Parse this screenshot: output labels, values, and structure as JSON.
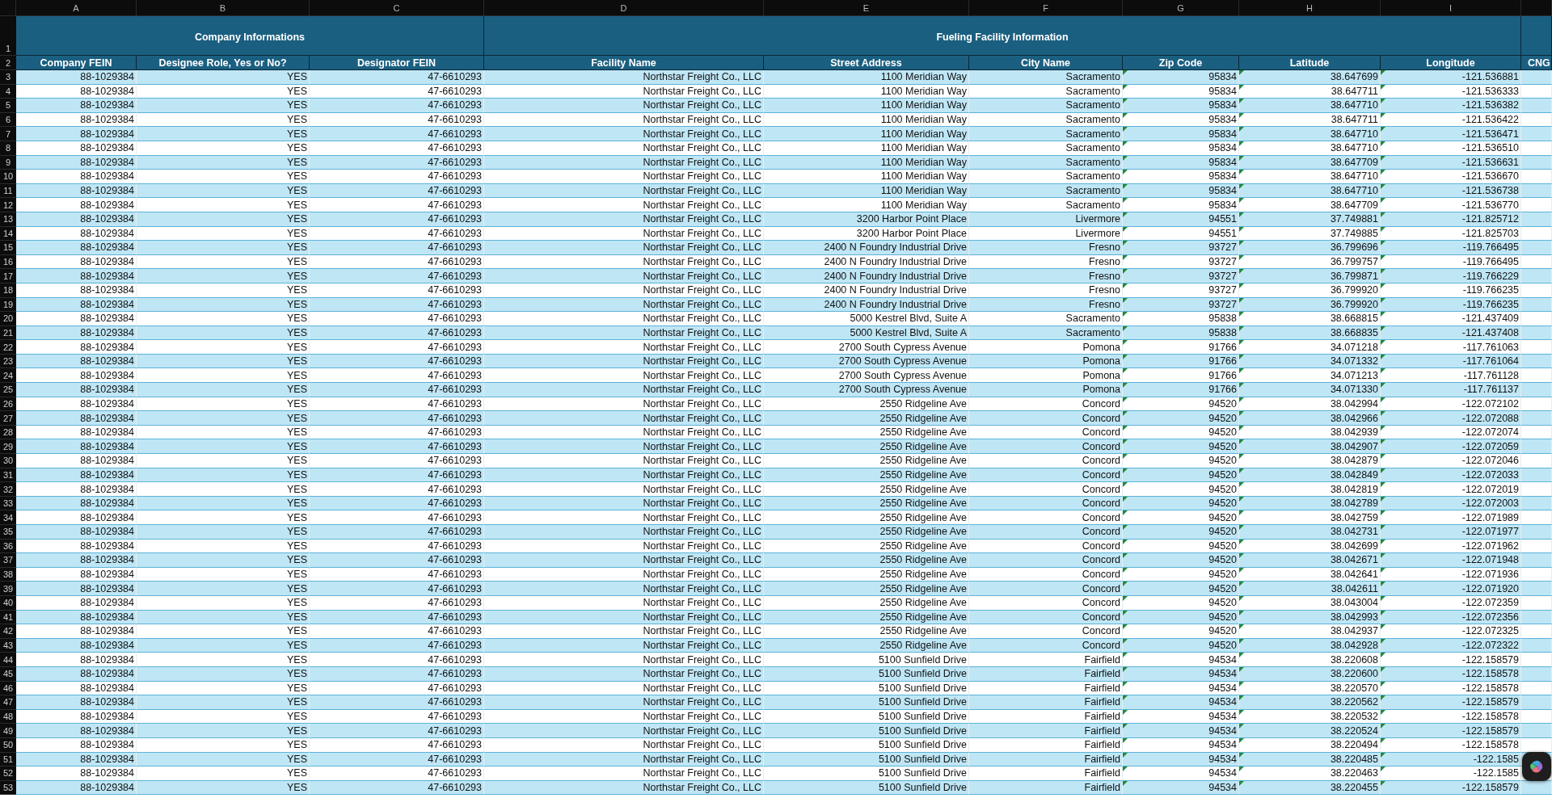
{
  "column_letters": [
    "A",
    "B",
    "C",
    "D",
    "E",
    "F",
    "G",
    "H",
    "I"
  ],
  "header_row_numbers": [
    "1",
    "2"
  ],
  "header_groups": [
    {
      "title": "Company Informations",
      "columns": [
        {
          "header": "Company FEIN",
          "flagged": false
        },
        {
          "header": "Designee Role, Yes or No?",
          "flagged": false
        },
        {
          "header": "Designator FEIN",
          "flagged": false
        }
      ]
    },
    {
      "title": "Fueling Facility Information",
      "columns": [
        {
          "header": "Facility Name",
          "flagged": false
        },
        {
          "header": "Street Address",
          "flagged": false
        },
        {
          "header": "City Name",
          "flagged": false
        },
        {
          "header": "Zip Code",
          "flagged": true
        },
        {
          "header": "Latitude",
          "flagged": true
        },
        {
          "header": "Longitude",
          "flagged": true
        }
      ]
    },
    {
      "columns": [
        {
          "header": "CNG",
          "flagged": false
        }
      ]
    }
  ],
  "rows": [
    {
      "number": "3",
      "cells": [
        "88-1029384",
        "YES",
        "47-6610293",
        "Northstar Freight Co., LLC",
        "1100 Meridian Way",
        "Sacramento",
        "95834",
        "38.647699",
        "-121.536881"
      ]
    },
    {
      "number": "4",
      "cells": [
        "88-1029384",
        "YES",
        "47-6610293",
        "Northstar Freight Co., LLC",
        "1100 Meridian Way",
        "Sacramento",
        "95834",
        "38.647711",
        "-121.536333"
      ]
    },
    {
      "number": "5",
      "cells": [
        "88-1029384",
        "YES",
        "47-6610293",
        "Northstar Freight Co., LLC",
        "1100 Meridian Way",
        "Sacramento",
        "95834",
        "38.647710",
        "-121.536382"
      ]
    },
    {
      "number": "6",
      "cells": [
        "88-1029384",
        "YES",
        "47-6610293",
        "Northstar Freight Co., LLC",
        "1100 Meridian Way",
        "Sacramento",
        "95834",
        "38.647711",
        "-121.536422"
      ]
    },
    {
      "number": "7",
      "cells": [
        "88-1029384",
        "YES",
        "47-6610293",
        "Northstar Freight Co., LLC",
        "1100 Meridian Way",
        "Sacramento",
        "95834",
        "38.647710",
        "-121.536471"
      ]
    },
    {
      "number": "8",
      "cells": [
        "88-1029384",
        "YES",
        "47-6610293",
        "Northstar Freight Co., LLC",
        "1100 Meridian Way",
        "Sacramento",
        "95834",
        "38.647710",
        "-121.536510"
      ]
    },
    {
      "number": "9",
      "cells": [
        "88-1029384",
        "YES",
        "47-6610293",
        "Northstar Freight Co., LLC",
        "1100 Meridian Way",
        "Sacramento",
        "95834",
        "38.647709",
        "-121.536631"
      ]
    },
    {
      "number": "10",
      "cells": [
        "88-1029384",
        "YES",
        "47-6610293",
        "Northstar Freight Co., LLC",
        "1100 Meridian Way",
        "Sacramento",
        "95834",
        "38.647710",
        "-121.536670"
      ]
    },
    {
      "number": "11",
      "cells": [
        "88-1029384",
        "YES",
        "47-6610293",
        "Northstar Freight Co., LLC",
        "1100 Meridian Way",
        "Sacramento",
        "95834",
        "38.647710",
        "-121.536738"
      ]
    },
    {
      "number": "12",
      "cells": [
        "88-1029384",
        "YES",
        "47-6610293",
        "Northstar Freight Co., LLC",
        "1100 Meridian Way",
        "Sacramento",
        "95834",
        "38.647709",
        "-121.536770"
      ]
    },
    {
      "number": "13",
      "cells": [
        "88-1029384",
        "YES",
        "47-6610293",
        "Northstar Freight Co., LLC",
        "3200 Harbor Point Place",
        "Livermore",
        "94551",
        "37.749881",
        "-121.825712"
      ]
    },
    {
      "number": "14",
      "cells": [
        "88-1029384",
        "YES",
        "47-6610293",
        "Northstar Freight Co., LLC",
        "3200 Harbor Point Place",
        "Livermore",
        "94551",
        "37.749885",
        "-121.825703"
      ]
    },
    {
      "number": "15",
      "cells": [
        "88-1029384",
        "YES",
        "47-6610293",
        "Northstar Freight Co., LLC",
        "2400 N Foundry Industrial Drive",
        "Fresno",
        "93727",
        "36.799696",
        "-119.766495"
      ]
    },
    {
      "number": "16",
      "cells": [
        "88-1029384",
        "YES",
        "47-6610293",
        "Northstar Freight Co., LLC",
        "2400 N Foundry Industrial Drive",
        "Fresno",
        "93727",
        "36.799757",
        "-119.766495"
      ]
    },
    {
      "number": "17",
      "cells": [
        "88-1029384",
        "YES",
        "47-6610293",
        "Northstar Freight Co., LLC",
        "2400 N Foundry Industrial Drive",
        "Fresno",
        "93727",
        "36.799871",
        "-119.766229"
      ]
    },
    {
      "number": "18",
      "cells": [
        "88-1029384",
        "YES",
        "47-6610293",
        "Northstar Freight Co., LLC",
        "2400 N Foundry Industrial Drive",
        "Fresno",
        "93727",
        "36.799920",
        "-119.766235"
      ]
    },
    {
      "number": "19",
      "cells": [
        "88-1029384",
        "YES",
        "47-6610293",
        "Northstar Freight Co., LLC",
        "2400 N Foundry Industrial Drive",
        "Fresno",
        "93727",
        "36.799920",
        "-119.766235"
      ]
    },
    {
      "number": "20",
      "cells": [
        "88-1029384",
        "YES",
        "47-6610293",
        "Northstar Freight Co., LLC",
        "5000 Kestrel Blvd, Suite A",
        "Sacramento",
        "95838",
        "38.668815",
        "-121.437409"
      ]
    },
    {
      "number": "21",
      "cells": [
        "88-1029384",
        "YES",
        "47-6610293",
        "Northstar Freight Co., LLC",
        "5000 Kestrel Blvd, Suite A",
        "Sacramento",
        "95838",
        "38.668835",
        "-121.437408"
      ]
    },
    {
      "number": "22",
      "cells": [
        "88-1029384",
        "YES",
        "47-6610293",
        "Northstar Freight Co., LLC",
        "2700 South Cypress Avenue",
        "Pomona",
        "91766",
        "34.071218",
        "-117.761063"
      ]
    },
    {
      "number": "23",
      "cells": [
        "88-1029384",
        "YES",
        "47-6610293",
        "Northstar Freight Co., LLC",
        "2700 South Cypress Avenue",
        "Pomona",
        "91766",
        "34.071332",
        "-117.761064"
      ]
    },
    {
      "number": "24",
      "cells": [
        "88-1029384",
        "YES",
        "47-6610293",
        "Northstar Freight Co., LLC",
        "2700 South Cypress Avenue",
        "Pomona",
        "91766",
        "34.071213",
        "-117.761128"
      ]
    },
    {
      "number": "25",
      "cells": [
        "88-1029384",
        "YES",
        "47-6610293",
        "Northstar Freight Co., LLC",
        "2700 South Cypress Avenue",
        "Pomona",
        "91766",
        "34.071330",
        "-117.761137"
      ]
    },
    {
      "number": "26",
      "cells": [
        "88-1029384",
        "YES",
        "47-6610293",
        "Northstar Freight Co., LLC",
        "2550 Ridgeline Ave",
        "Concord",
        "94520",
        "38.042994",
        "-122.072102"
      ]
    },
    {
      "number": "27",
      "cells": [
        "88-1029384",
        "YES",
        "47-6610293",
        "Northstar Freight Co., LLC",
        "2550 Ridgeline Ave",
        "Concord",
        "94520",
        "38.042966",
        "-122.072088"
      ]
    },
    {
      "number": "28",
      "cells": [
        "88-1029384",
        "YES",
        "47-6610293",
        "Northstar Freight Co., LLC",
        "2550 Ridgeline Ave",
        "Concord",
        "94520",
        "38.042939",
        "-122.072074"
      ]
    },
    {
      "number": "29",
      "cells": [
        "88-1029384",
        "YES",
        "47-6610293",
        "Northstar Freight Co., LLC",
        "2550 Ridgeline Ave",
        "Concord",
        "94520",
        "38.042907",
        "-122.072059"
      ]
    },
    {
      "number": "30",
      "cells": [
        "88-1029384",
        "YES",
        "47-6610293",
        "Northstar Freight Co., LLC",
        "2550 Ridgeline Ave",
        "Concord",
        "94520",
        "38.042879",
        "-122.072046"
      ]
    },
    {
      "number": "31",
      "cells": [
        "88-1029384",
        "YES",
        "47-6610293",
        "Northstar Freight Co., LLC",
        "2550 Ridgeline Ave",
        "Concord",
        "94520",
        "38.042849",
        "-122.072033"
      ]
    },
    {
      "number": "32",
      "cells": [
        "88-1029384",
        "YES",
        "47-6610293",
        "Northstar Freight Co., LLC",
        "2550 Ridgeline Ave",
        "Concord",
        "94520",
        "38.042819",
        "-122.072019"
      ]
    },
    {
      "number": "33",
      "cells": [
        "88-1029384",
        "YES",
        "47-6610293",
        "Northstar Freight Co., LLC",
        "2550 Ridgeline Ave",
        "Concord",
        "94520",
        "38.042789",
        "-122.072003"
      ]
    },
    {
      "number": "34",
      "cells": [
        "88-1029384",
        "YES",
        "47-6610293",
        "Northstar Freight Co., LLC",
        "2550 Ridgeline Ave",
        "Concord",
        "94520",
        "38.042759",
        "-122.071989"
      ]
    },
    {
      "number": "35",
      "cells": [
        "88-1029384",
        "YES",
        "47-6610293",
        "Northstar Freight Co., LLC",
        "2550 Ridgeline Ave",
        "Concord",
        "94520",
        "38.042731",
        "-122.071977"
      ]
    },
    {
      "number": "36",
      "cells": [
        "88-1029384",
        "YES",
        "47-6610293",
        "Northstar Freight Co., LLC",
        "2550 Ridgeline Ave",
        "Concord",
        "94520",
        "38.042699",
        "-122.071962"
      ]
    },
    {
      "number": "37",
      "cells": [
        "88-1029384",
        "YES",
        "47-6610293",
        "Northstar Freight Co., LLC",
        "2550 Ridgeline Ave",
        "Concord",
        "94520",
        "38.042671",
        "-122.071948"
      ]
    },
    {
      "number": "38",
      "cells": [
        "88-1029384",
        "YES",
        "47-6610293",
        "Northstar Freight Co., LLC",
        "2550 Ridgeline Ave",
        "Concord",
        "94520",
        "38.042641",
        "-122.071936"
      ]
    },
    {
      "number": "39",
      "cells": [
        "88-1029384",
        "YES",
        "47-6610293",
        "Northstar Freight Co., LLC",
        "2550 Ridgeline Ave",
        "Concord",
        "94520",
        "38.042611",
        "-122.071920"
      ]
    },
    {
      "number": "40",
      "cells": [
        "88-1029384",
        "YES",
        "47-6610293",
        "Northstar Freight Co., LLC",
        "2550 Ridgeline Ave",
        "Concord",
        "94520",
        "38.043004",
        "-122.072359"
      ]
    },
    {
      "number": "41",
      "cells": [
        "88-1029384",
        "YES",
        "47-6610293",
        "Northstar Freight Co., LLC",
        "2550 Ridgeline Ave",
        "Concord",
        "94520",
        "38.042993",
        "-122.072356"
      ]
    },
    {
      "number": "42",
      "cells": [
        "88-1029384",
        "YES",
        "47-6610293",
        "Northstar Freight Co., LLC",
        "2550 Ridgeline Ave",
        "Concord",
        "94520",
        "38.042937",
        "-122.072325"
      ]
    },
    {
      "number": "43",
      "cells": [
        "88-1029384",
        "YES",
        "47-6610293",
        "Northstar Freight Co., LLC",
        "2550 Ridgeline Ave",
        "Concord",
        "94520",
        "38.042928",
        "-122.072322"
      ]
    },
    {
      "number": "44",
      "cells": [
        "88-1029384",
        "YES",
        "47-6610293",
        "Northstar Freight Co., LLC",
        "5100 Sunfield Drive",
        "Fairfield",
        "94534",
        "38.220608",
        "-122.158579"
      ]
    },
    {
      "number": "45",
      "cells": [
        "88-1029384",
        "YES",
        "47-6610293",
        "Northstar Freight Co., LLC",
        "5100 Sunfield Drive",
        "Fairfield",
        "94534",
        "38.220600",
        "-122.158578"
      ]
    },
    {
      "number": "46",
      "cells": [
        "88-1029384",
        "YES",
        "47-6610293",
        "Northstar Freight Co., LLC",
        "5100 Sunfield Drive",
        "Fairfield",
        "94534",
        "38.220570",
        "-122.158578"
      ]
    },
    {
      "number": "47",
      "cells": [
        "88-1029384",
        "YES",
        "47-6610293",
        "Northstar Freight Co., LLC",
        "5100 Sunfield Drive",
        "Fairfield",
        "94534",
        "38.220562",
        "-122.158579"
      ]
    },
    {
      "number": "48",
      "cells": [
        "88-1029384",
        "YES",
        "47-6610293",
        "Northstar Freight Co., LLC",
        "5100 Sunfield Drive",
        "Fairfield",
        "94534",
        "38.220532",
        "-122.158578"
      ]
    },
    {
      "number": "49",
      "cells": [
        "88-1029384",
        "YES",
        "47-6610293",
        "Northstar Freight Co., LLC",
        "5100 Sunfield Drive",
        "Fairfield",
        "94534",
        "38.220524",
        "-122.158579"
      ]
    },
    {
      "number": "50",
      "cells": [
        "88-1029384",
        "YES",
        "47-6610293",
        "Northstar Freight Co., LLC",
        "5100 Sunfield Drive",
        "Fairfield",
        "94534",
        "38.220494",
        "-122.158578"
      ]
    },
    {
      "number": "51",
      "cells": [
        "88-1029384",
        "YES",
        "47-6610293",
        "Northstar Freight Co., LLC",
        "5100 Sunfield Drive",
        "Fairfield",
        "94534",
        "38.220485",
        "-122.1585"
      ]
    },
    {
      "number": "52",
      "cells": [
        "88-1029384",
        "YES",
        "47-6610293",
        "Northstar Freight Co., LLC",
        "5100 Sunfield Drive",
        "Fairfield",
        "94534",
        "38.220463",
        "-122.1585"
      ]
    },
    {
      "number": "53",
      "cells": [
        "88-1029384",
        "YES",
        "47-6610293",
        "Northstar Freight Co., LLC",
        "5100 Sunfield Drive",
        "Fairfield",
        "94534",
        "38.220455",
        "-122.158579"
      ]
    }
  ]
}
